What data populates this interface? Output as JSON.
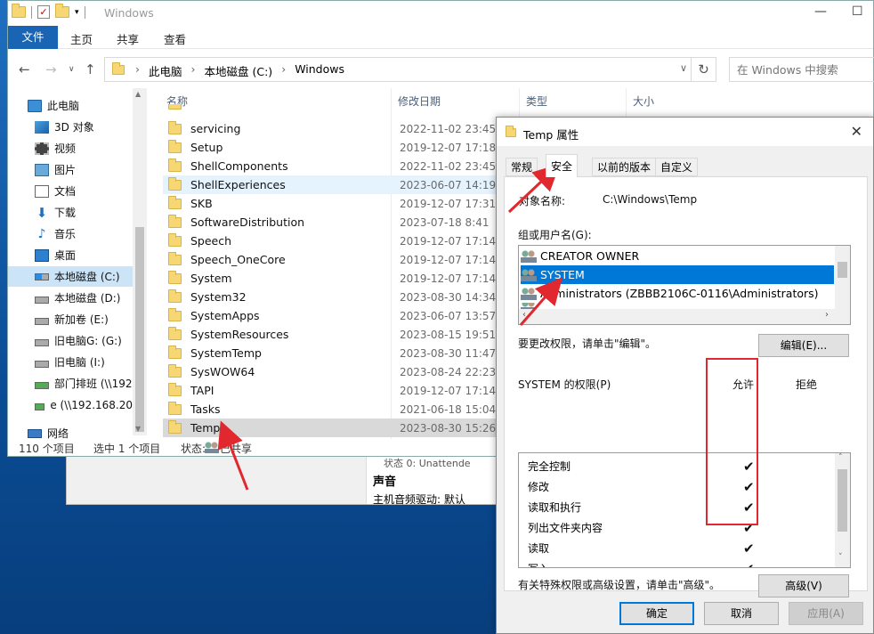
{
  "explorer": {
    "title": "Windows",
    "ribbon": {
      "file": "文件",
      "home": "主页",
      "share": "共享",
      "view": "查看"
    },
    "address": {
      "crumbs": [
        "此电脑",
        "本地磁盘 (C:)",
        "Windows"
      ]
    },
    "search_placeholder": "在 Windows 中搜索",
    "sidebar": [
      {
        "label": "此电脑",
        "icon": "pc-icon"
      },
      {
        "label": "3D 对象",
        "icon": "3d-objects-icon"
      },
      {
        "label": "视频",
        "icon": "video-icon"
      },
      {
        "label": "图片",
        "icon": "pictures-icon"
      },
      {
        "label": "文档",
        "icon": "documents-icon"
      },
      {
        "label": "下载",
        "icon": "download-icon"
      },
      {
        "label": "音乐",
        "icon": "music-icon"
      },
      {
        "label": "桌面",
        "icon": "desktop-icon"
      },
      {
        "label": "本地磁盘 (C:)",
        "icon": "system-drive-icon"
      },
      {
        "label": "本地磁盘 (D:)",
        "icon": "drive-icon"
      },
      {
        "label": "新加卷 (E:)",
        "icon": "drive-icon"
      },
      {
        "label": "旧电脑G: (G:)",
        "icon": "drive-icon"
      },
      {
        "label": "旧电脑 (I:)",
        "icon": "drive-icon"
      },
      {
        "label": "部门排班 (\\\\192",
        "icon": "network-drive-icon"
      },
      {
        "label": "e (\\\\192.168.20",
        "icon": "network-drive-icon"
      },
      {
        "label": "网络",
        "icon": "network-icon"
      }
    ],
    "columns": {
      "name": "名称",
      "date": "修改日期",
      "type": "类型",
      "size": "大小"
    },
    "files": [
      {
        "name": "servicing",
        "date": "2022-11-02 23:45"
      },
      {
        "name": "Setup",
        "date": "2019-12-07 17:18"
      },
      {
        "name": "ShellComponents",
        "date": "2022-11-02 23:45"
      },
      {
        "name": "ShellExperiences",
        "date": "2023-06-07 14:19"
      },
      {
        "name": "SKB",
        "date": "2019-12-07 17:31"
      },
      {
        "name": "SoftwareDistribution",
        "date": "2023-07-18 8:41"
      },
      {
        "name": "Speech",
        "date": "2019-12-07 17:14"
      },
      {
        "name": "Speech_OneCore",
        "date": "2019-12-07 17:14"
      },
      {
        "name": "System",
        "date": "2019-12-07 17:14"
      },
      {
        "name": "System32",
        "date": "2023-08-30 14:34"
      },
      {
        "name": "SystemApps",
        "date": "2023-06-07 13:57"
      },
      {
        "name": "SystemResources",
        "date": "2023-08-15 19:51"
      },
      {
        "name": "SystemTemp",
        "date": "2023-08-30 11:47"
      },
      {
        "name": "SysWOW64",
        "date": "2023-08-24 22:23"
      },
      {
        "name": "TAPI",
        "date": "2019-12-07 17:14"
      },
      {
        "name": "Tasks",
        "date": "2021-06-18 15:04"
      },
      {
        "name": "Temp",
        "date": "2023-08-30 15:26"
      }
    ],
    "status": {
      "count": "110 个项目",
      "selected": "选中 1 个项目",
      "state_label": "状态:",
      "state_value": "已共享"
    }
  },
  "background_window": {
    "row1": "状态 0:    Unattende",
    "row2": "声音",
    "row3": "主机音频驱动:  默认"
  },
  "dialog": {
    "title": "Temp 属性",
    "tabs": [
      "常规",
      "安全",
      "以前的版本",
      "自定义"
    ],
    "object_label": "对象名称:",
    "object_value": "C:\\Windows\\Temp",
    "groups_label": "组或用户名(G):",
    "users": [
      "CREATOR OWNER",
      "SYSTEM",
      "Administrators (ZBBB2106C-0116\\Administrators)"
    ],
    "change_hint": "要更改权限，请单击\"编辑\"。",
    "edit_button": "编辑(E)...",
    "perm_label": "SYSTEM 的权限(P)",
    "allow": "允许",
    "deny": "拒绝",
    "permissions": [
      "完全控制",
      "修改",
      "读取和执行",
      "列出文件夹内容",
      "读取",
      "写入"
    ],
    "check_glyph": "✔",
    "advanced_hint": "有关特殊权限或高级设置，请单击\"高级\"。",
    "advanced_button": "高级(V)",
    "ok": "确定",
    "cancel": "取消",
    "apply": "应用(A)"
  },
  "colors": {
    "accent": "#0078d7",
    "annotation": "#e0282e"
  }
}
